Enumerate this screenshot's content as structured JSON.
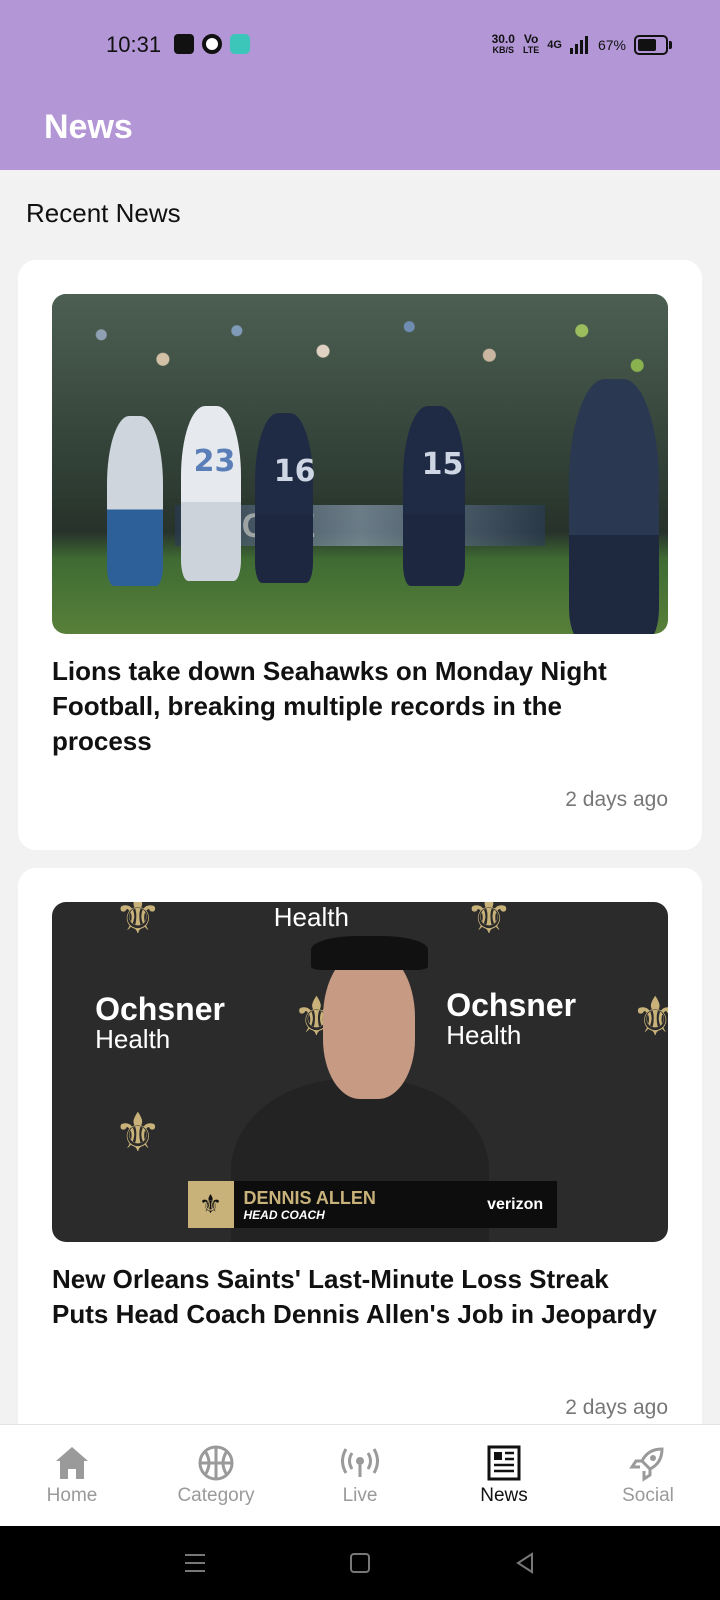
{
  "status_bar": {
    "time": "10:31",
    "speed_value": "30.0",
    "speed_unit": "KB/S",
    "volte_top": "Vo",
    "volte_bottom": "LTE",
    "network": "4G",
    "battery": "67%"
  },
  "app_bar": {
    "title": "News"
  },
  "section": {
    "title": "Recent News"
  },
  "articles": [
    {
      "headline": "Lions take down Seahawks on Monday Night Football, breaking multiple records in the process",
      "time": "2 days ago",
      "image": {
        "banner_text": "GRE",
        "jersey_numbers": [
          "23",
          "16",
          "15"
        ]
      }
    },
    {
      "headline": "New Orleans Saints' Last-Minute Loss Streak Puts Head Coach Dennis Allen's Job in Jeopardy",
      "time": "2 days ago",
      "image": {
        "sponsor_name": "Ochsner",
        "sponsor_sub": "Health",
        "lower_third_name": "DENNIS ALLEN",
        "lower_third_role": "HEAD COACH",
        "lower_third_brand": "verizon",
        "fleur_symbol": "⚜"
      }
    }
  ],
  "bottom_nav": [
    {
      "label": "Home",
      "icon": "home-icon",
      "active": false
    },
    {
      "label": "Category",
      "icon": "basketball-icon",
      "active": false
    },
    {
      "label": "Live",
      "icon": "broadcast-icon",
      "active": false
    },
    {
      "label": "News",
      "icon": "newspaper-icon",
      "active": true
    },
    {
      "label": "Social",
      "icon": "rocket-icon",
      "active": false
    }
  ],
  "colors": {
    "header": "#b396d6",
    "active_nav": "#111111",
    "inactive_nav": "#9a9a9a",
    "saints_gold": "#c9b27a"
  }
}
